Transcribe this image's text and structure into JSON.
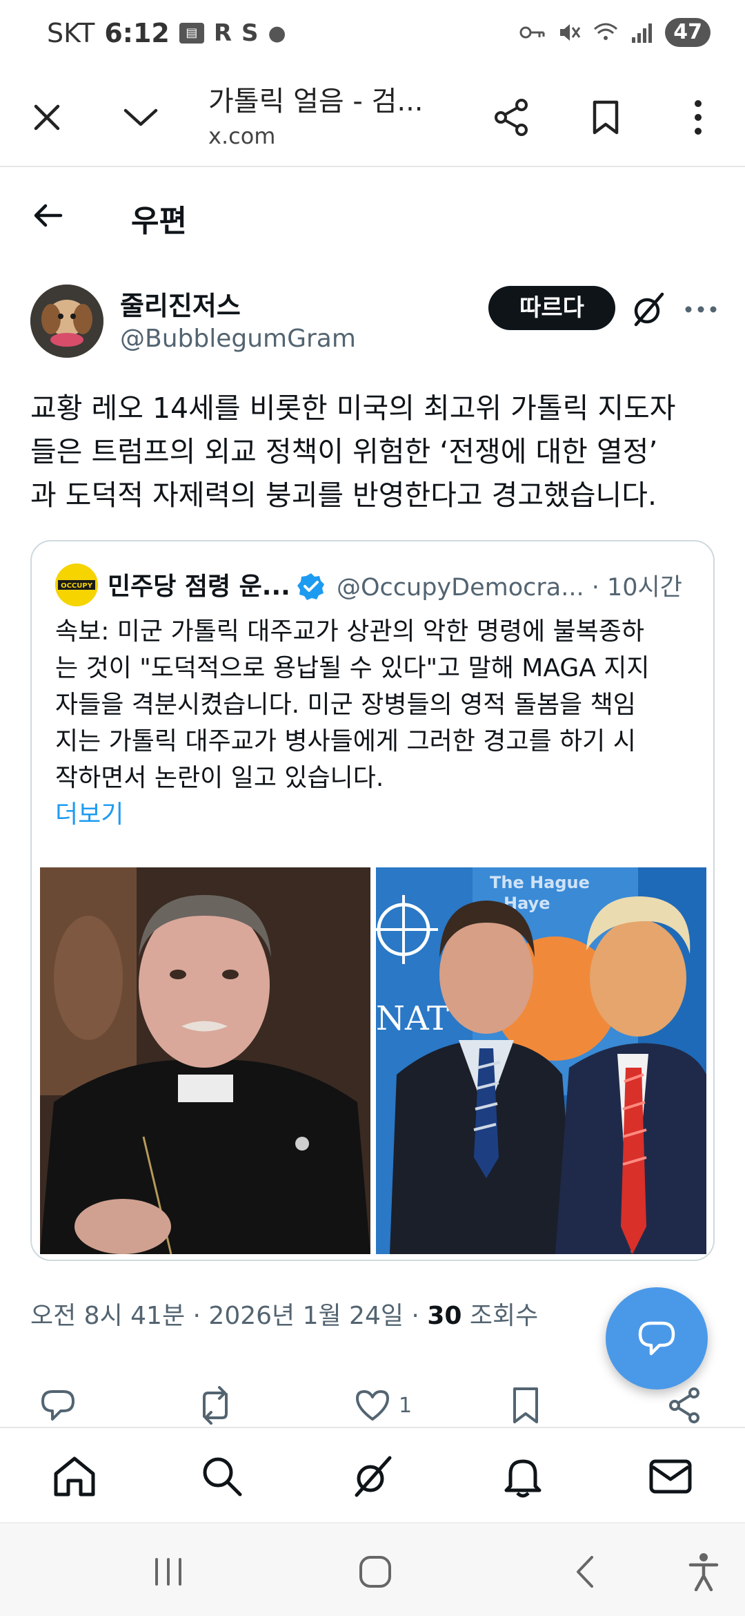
{
  "status_bar": {
    "carrier": "SKT",
    "time": "6:12",
    "battery": "47"
  },
  "browser": {
    "title": "가톨릭 얼음 - 검...",
    "url": "x.com"
  },
  "header": {
    "title": "우편"
  },
  "tweet": {
    "author_name": "줄리진저스",
    "author_handle": "@BubblegumGram",
    "follow_label": "따르다",
    "text_lines": [
      "교황 레오 14세를 비롯한 미국의 최고위 가톨릭 지도자",
      "들은 트럼프의 외교 정책이 위험한 ‘전쟁에 대한 열정’",
      "과 도덕적 자제력의 붕괴를 반영한다고 경고했습니다."
    ],
    "time": "오전 8시 41분 · 2026년 1월 24일 · ",
    "views_count": "30",
    "views_label": " 조회수",
    "like_count": "1"
  },
  "quote": {
    "name": "민주당 점령 운...",
    "handle_time": "@OccupyDemocra... · 10시간",
    "avatar_text": "OCCUPY",
    "text_lines": [
      "속보: 미군 가톨릭 대주교가 상관의 악한 명령에 불복종하",
      "는 것이 \"도덕적으로 용납될 수 있다\"고 말해 MAGA 지지",
      "자들을 격분시켰습니다. 미군 장병들의 영적 돌봄을 책임",
      "지는 가톨릭 대주교가 병사들에게 그러한 경고를 하기 시",
      "작하면서 논란이 일고 있습니다."
    ],
    "more_label": "더보기",
    "image_text_1": "The Hague",
    "image_text_2": "Haye",
    "image_text_3": "NAT"
  },
  "colors": {
    "accent": "#1d9bf0",
    "fab": "#4a99e9",
    "follow_bg": "#0f1419",
    "muted": "#536471"
  }
}
